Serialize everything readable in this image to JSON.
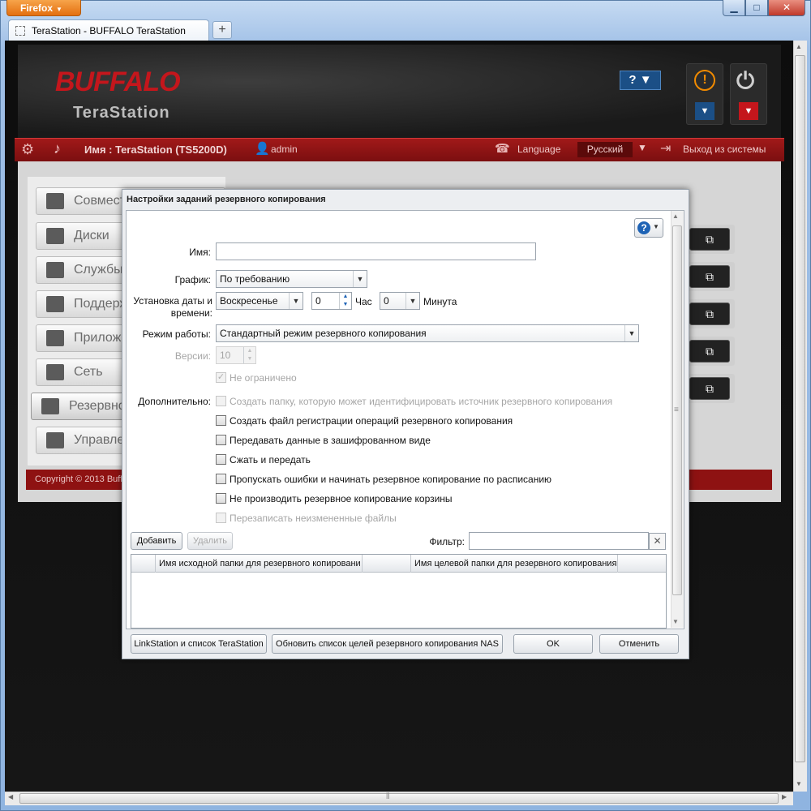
{
  "browser": {
    "menu_button": "Firefox",
    "tab_title": "TeraStation - BUFFALO TeraStation",
    "new_tab": "+",
    "min_glyph": "▁",
    "max_glyph": "□",
    "close_glyph": "✕"
  },
  "header": {
    "logo_brand": "BUFFALO",
    "logo_product": "TeraStation",
    "help_button": "? ▼",
    "alert_glyph": "!",
    "power_glyph": "⏻",
    "drop_glyph": "▼"
  },
  "topbar": {
    "device_name": "Имя : TeraStation (TS5200D)",
    "user": "admin",
    "language_label": "Language",
    "language_value": "Русский",
    "language_caret": "▼",
    "logout": "Выход из системы"
  },
  "sidebar": {
    "items": [
      {
        "label": "Совместный доступ к файлу"
      },
      {
        "label": "Диски"
      },
      {
        "label": "Службы"
      },
      {
        "label": "Поддержка"
      },
      {
        "label": "Приложения"
      },
      {
        "label": "Сеть"
      },
      {
        "label": "Резервное копирование"
      },
      {
        "label": "Управление"
      }
    ]
  },
  "footer": {
    "copyright": "Copyright © 2013 Buffalo Inc."
  },
  "dialog": {
    "title": "Настройки заданий резервного копирования",
    "name_label": "Имя:",
    "name_value": "",
    "schedule_label": "График:",
    "schedule_value": "По требованию",
    "datetime_label": "Установка даты и времени:",
    "day_value": "Воскресенье",
    "hour_value": "0",
    "hour_unit": "Час",
    "minute_value": "0",
    "minute_unit": "Минута",
    "mode_label": "Режим работы:",
    "mode_value": "Стандартный режим резервного копирования",
    "versions_label": "Версии:",
    "versions_value": "10",
    "unlimited_label": "Не ограничено",
    "extra_label": "Дополнительно:",
    "options": [
      {
        "label": "Создать папку, которую может идентифицировать источник резервного копирования",
        "checked": false,
        "disabled": true
      },
      {
        "label": "Создать файл регистрации операций резервного копирования",
        "checked": false,
        "disabled": false
      },
      {
        "label": "Передавать данные в зашифрованном виде",
        "checked": false,
        "disabled": false
      },
      {
        "label": "Сжать и передать",
        "checked": false,
        "disabled": false
      },
      {
        "label": "Пропускать ошибки и начинать резервное копирование по расписанию",
        "checked": false,
        "disabled": false
      },
      {
        "label": "Не производить резервное копирование корзины",
        "checked": false,
        "disabled": false
      },
      {
        "label": "Перезаписать неизмененные файлы",
        "checked": false,
        "disabled": true
      }
    ],
    "add_button": "Добавить",
    "delete_button": "Удалить",
    "filter_label": "Фильтр:",
    "filter_value": "",
    "columns": [
      "Имя исходной папки для резервного копировани",
      "Имя целевой папки для резервного копирования"
    ],
    "linkstation_button": "LinkStation и список TeraStation",
    "refresh_button": "Обновить список целей резервного копирования NAS",
    "ok_button": "OK",
    "cancel_button": "Отменить"
  }
}
